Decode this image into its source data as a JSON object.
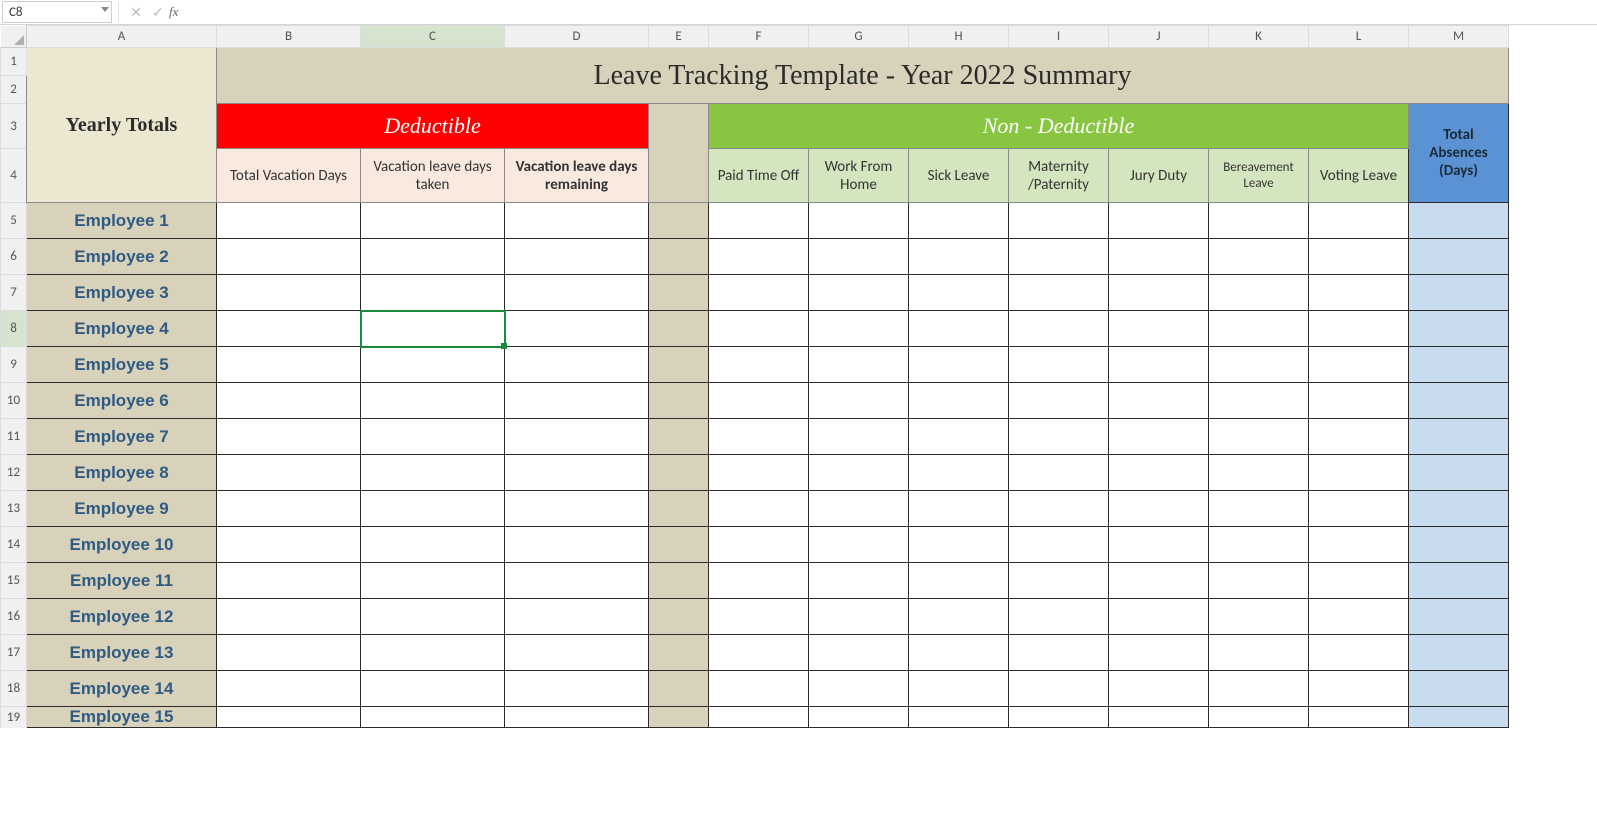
{
  "nameBox": "C8",
  "formula": "",
  "columns": [
    "A",
    "B",
    "C",
    "D",
    "E",
    "F",
    "G",
    "H",
    "I",
    "J",
    "K",
    "L",
    "M"
  ],
  "rows": [
    "1",
    "2",
    "3",
    "4",
    "5",
    "6",
    "7",
    "8",
    "9",
    "10",
    "11",
    "12",
    "13",
    "14",
    "15",
    "16",
    "17",
    "18",
    "19"
  ],
  "selectedCol": "C",
  "selectedRow": "8",
  "labels": {
    "yearlyTotals": "Yearly Totals",
    "title": "Leave Tracking Template - Year 2022 Summary",
    "deductible": "Deductible",
    "nonDeductible": "Non - Deductible",
    "totalAbsences": "Total Absences (Days)"
  },
  "deductibleCols": [
    {
      "label": "Total Vacation Days",
      "bold": false
    },
    {
      "label": "Vacation leave days taken",
      "bold": false
    },
    {
      "label": "Vacation leave days remaining",
      "bold": true
    }
  ],
  "nonDeductibleCols": [
    "Paid Time Off",
    "Work From Home",
    "Sick Leave",
    "Maternity /Paternity",
    "Jury Duty",
    "Bereavement Leave",
    "Voting Leave"
  ],
  "employees": [
    "Employee 1",
    "Employee 2",
    "Employee 3",
    "Employee 4",
    "Employee 5",
    "Employee 6",
    "Employee 7",
    "Employee 8",
    "Employee 9",
    "Employee 10",
    "Employee 11",
    "Employee 12",
    "Employee 13",
    "Employee 14",
    "Employee 15"
  ]
}
